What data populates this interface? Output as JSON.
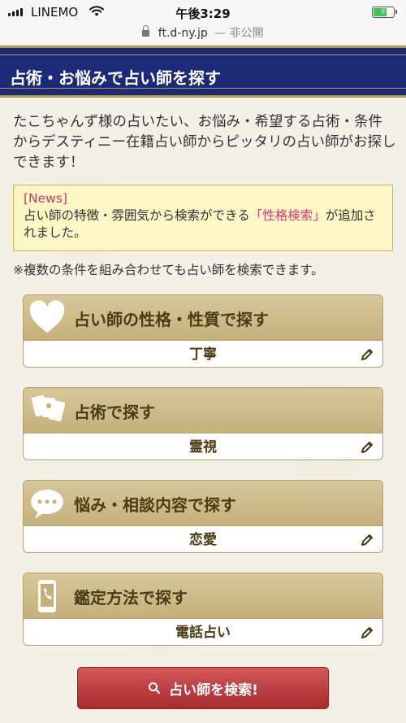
{
  "status_bar": {
    "carrier": "LINEMO",
    "time": "午後3:29"
  },
  "url_bar": {
    "domain": "ft.d-ny.jp",
    "privacy": "— 非公開"
  },
  "header": {
    "title": "占術・お悩みで占い師を探す"
  },
  "intro": {
    "text": "たこちゃんず様の占いたい、お悩み・希望する占術・条件からデスティニー在籍占い師からピッタリの占い師がお探しできます！"
  },
  "news": {
    "tag": "[News]",
    "text_before": "占い師の特徴・雰囲気から検索ができる",
    "highlight": "「性格検索」",
    "text_after": "が追加されました。"
  },
  "note": "※複数の条件を組み合わせても占い師を検索できます。",
  "cards": [
    {
      "title": "占い師の性格・性質で探す",
      "value": "丁寧",
      "icon": "heart-icon"
    },
    {
      "title": "占術で探す",
      "value": "霊視",
      "icon": "tarot-cards-icon"
    },
    {
      "title": "悩み・相談内容で探す",
      "value": "恋愛",
      "icon": "speech-bubble-icon"
    },
    {
      "title": "鑑定方法で探す",
      "value": "電話占い",
      "icon": "phone-icon"
    }
  ],
  "submit": {
    "label": "占い師を検索!",
    "icon": "search-icon"
  },
  "colors": {
    "header_bg": "#1c2a7a",
    "gold": "#b59a48",
    "card_head": "#c4b07a",
    "submit": "#b8383b",
    "news_bg": "#fcf7c4",
    "news_accent": "#d83a78"
  }
}
